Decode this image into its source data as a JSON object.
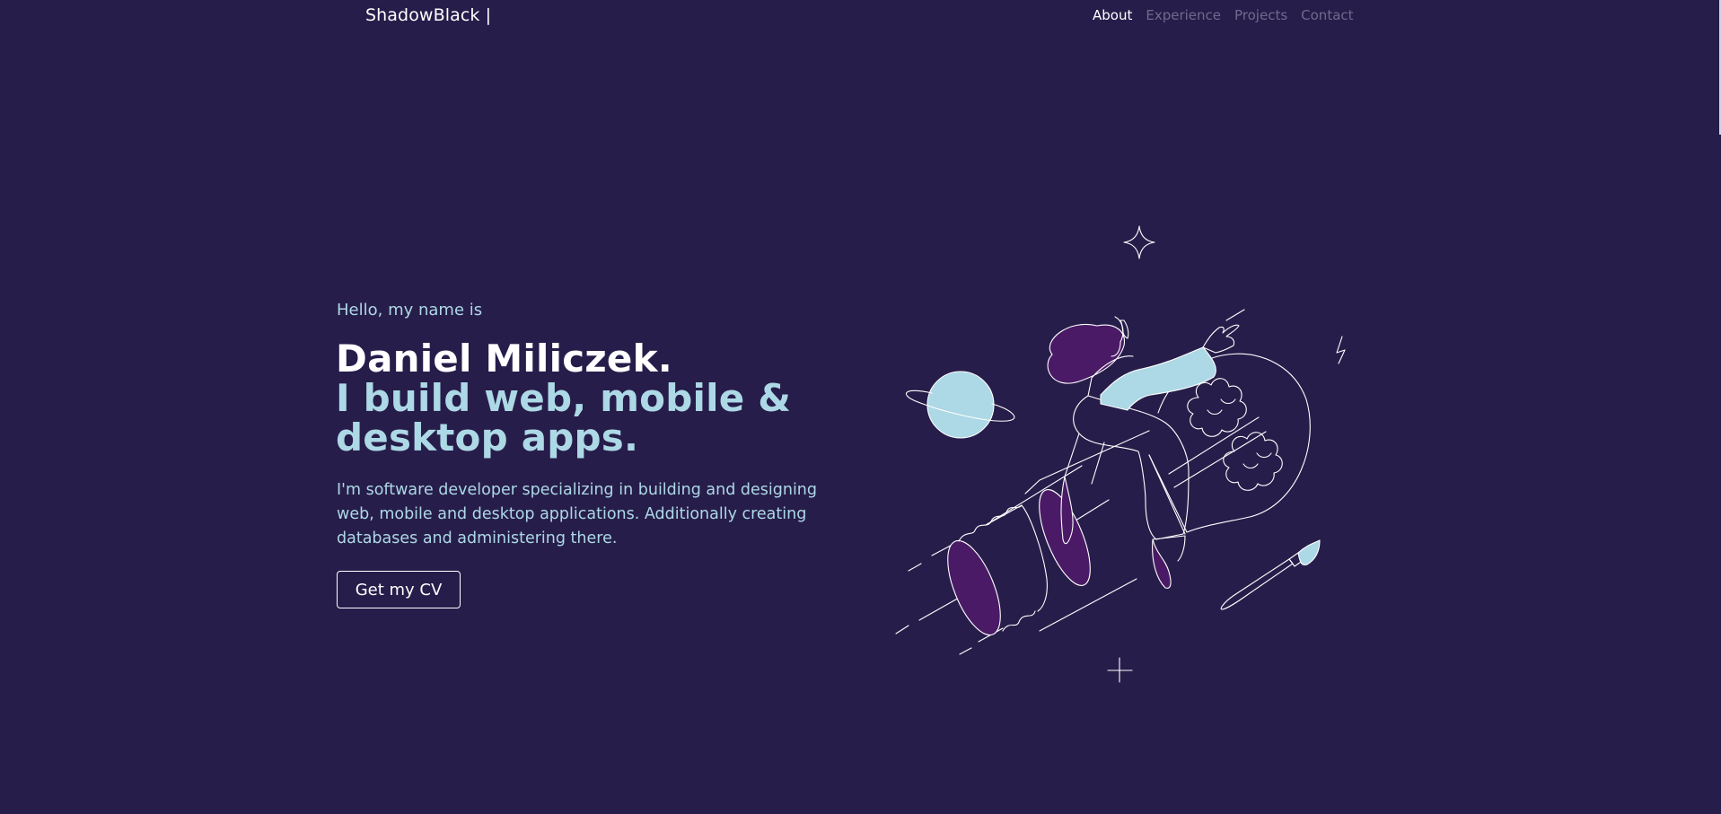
{
  "nav": {
    "brand": "ShadowBlack |",
    "links": [
      {
        "label": "About",
        "active": true
      },
      {
        "label": "Experience",
        "active": false
      },
      {
        "label": "Projects",
        "active": false
      },
      {
        "label": "Contact",
        "active": false
      }
    ]
  },
  "hero": {
    "greeting": "Hello, my name is",
    "name": "Daniel Miliczek.",
    "tagline": "I build web, mobile & desktop apps.",
    "description": "I'm software developer specializing in building and designing web, mobile and desktop applications. Additionally creating databases and administering there.",
    "cv_button": "Get my CV"
  },
  "colors": {
    "background": "#271d4a",
    "accent": "#add8e6",
    "purple": "#4a1a66",
    "text": "#ffffff",
    "nav_inactive": "#6f6a8d"
  }
}
